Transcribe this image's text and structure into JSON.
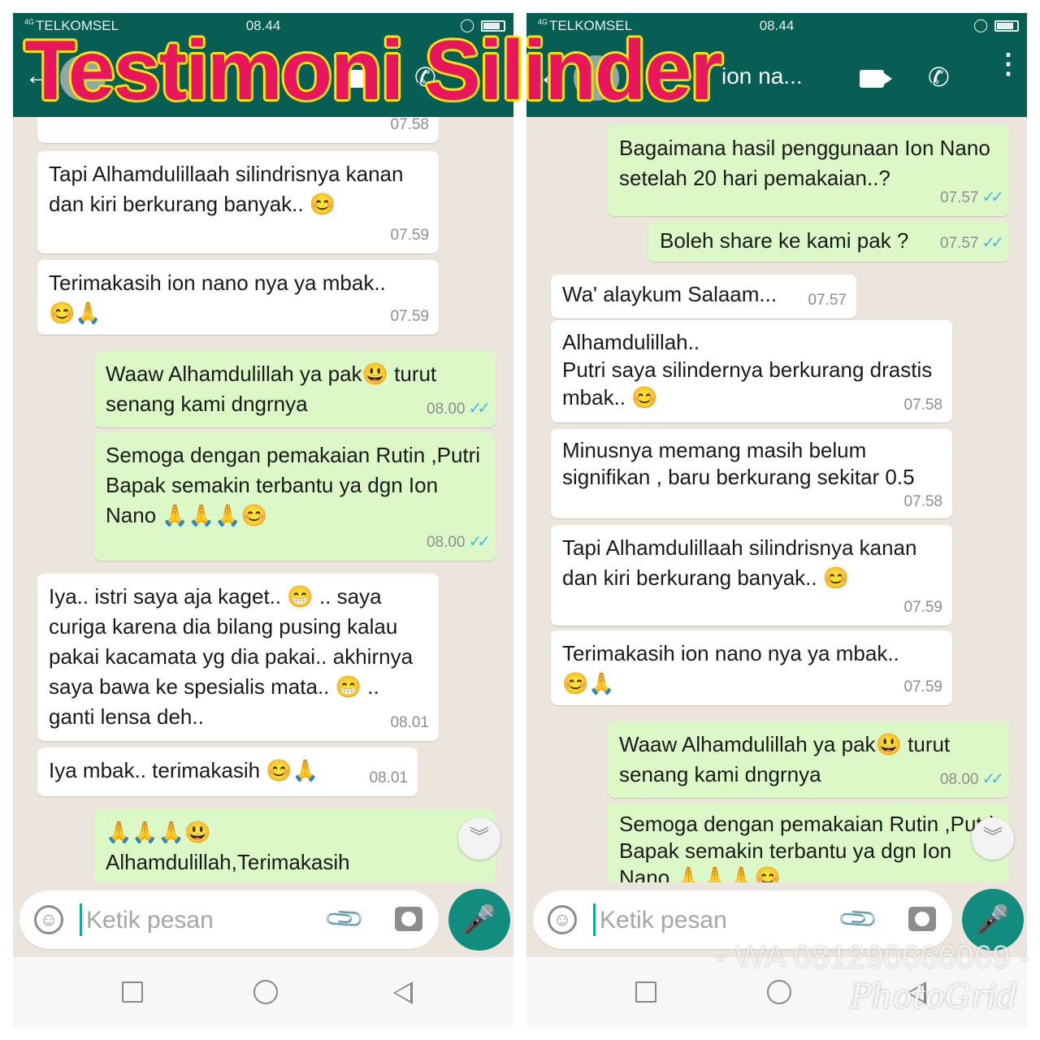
{
  "overlay": {
    "headline": "Testimoni Silinder",
    "watermark": "- WA 081290666069 -",
    "photogrid_logo": "PhotoGrid"
  },
  "status_bar": {
    "network": "4G",
    "carrier": "TELKOMSEL",
    "time": "08.44"
  },
  "right_header": {
    "contact_name_fragment": "ion na..."
  },
  "left_chat": {
    "messages": [
      {
        "dir": "in",
        "text": "",
        "time": "07.58"
      },
      {
        "dir": "in",
        "text": "Tapi Alhamdulillaah silindrisnya kanan dan kiri berkurang banyak..",
        "emoji": "😊",
        "time": "07.59"
      },
      {
        "dir": "in",
        "text": "Terimakasih ion nano nya ya mbak..",
        "emoji": "😊🙏",
        "time": "07.59"
      },
      {
        "dir": "out",
        "text_a": "Waaw Alhamdulillah ya pak",
        "emoji": "😃",
        "text_b": " turut senang kami dngrnya",
        "time": "08.00"
      },
      {
        "dir": "out",
        "text": "Semoga dengan pemakaian Rutin ,Putri Bapak semakin terbantu ya dgn Ion Nano ",
        "emoji": "🙏🙏🙏😊",
        "time": "08.00"
      },
      {
        "dir": "in",
        "text_a": "Iya.. istri saya aja kaget.. ",
        "emoji_a": "😁",
        "text_b": " .. saya curiga karena dia bilang pusing kalau pakai kacamata yg dia pakai.. akhirnya saya bawa ke spesialis mata.. ",
        "emoji_b": "😁",
        "text_c": " .. ganti lensa deh..",
        "time": "08.01"
      },
      {
        "dir": "in",
        "text": "Iya mbak.. terimakasih ",
        "emoji": "😊🙏",
        "time": "08.01"
      },
      {
        "dir": "out",
        "emoji": "🙏🙏🙏😃",
        "text": "Alhamdulillah,Terimakasih"
      }
    ]
  },
  "right_chat": {
    "messages": [
      {
        "dir": "out",
        "text": "Bagaimana hasil penggunaan Ion Nano setelah 20 hari pemakaian..?",
        "time": "07.57"
      },
      {
        "dir": "out",
        "text": "Boleh share ke kami pak ?",
        "time": "07.57"
      },
      {
        "dir": "in",
        "text": "Wa' alaykum Salaam...",
        "time": "07.57"
      },
      {
        "dir": "in",
        "text_a": "Alhamdulillah..",
        "text_b": "Putri saya silindernya berkurang drastis mbak.. ",
        "emoji": "😊",
        "time": "07.58"
      },
      {
        "dir": "in",
        "text": "Minusnya memang masih belum signifikan , baru berkurang sekitar 0.5",
        "time": "07.58"
      },
      {
        "dir": "in",
        "text": "Tapi Alhamdulillaah silindrisnya kanan dan kiri berkurang banyak..",
        "emoji": "😊",
        "time": "07.59"
      },
      {
        "dir": "in",
        "text": "Terimakasih ion nano nya ya mbak..",
        "emoji": "😊🙏",
        "time": "07.59"
      },
      {
        "dir": "out",
        "text_a": "Waaw Alhamdulillah ya pak",
        "emoji": "😃",
        "text_b": " turut senang kami dngrnya",
        "time": "08.00"
      },
      {
        "dir": "out",
        "text": "Semoga dengan pemakaian Rutin ,Putri Bapak semakin terbantu ya dgn Ion Nano ",
        "emoji": "🙏🙏🙏😊"
      }
    ]
  },
  "composer": {
    "placeholder": "Ketik pesan"
  },
  "icons": {
    "back": "arrow-left-icon",
    "video": "video-camera-icon",
    "call": "phone-icon",
    "menu": "more-vert-icon",
    "emoji": "emoji-icon",
    "attach": "paperclip-icon",
    "camera": "camera-icon",
    "mic": "mic-icon",
    "scroll": "chevron-double-down-icon",
    "read": "double-check-icon"
  },
  "colors": {
    "header": "#075e54",
    "chat_bg": "#ece5dd",
    "outgoing_bubble": "#dcf8c6",
    "incoming_bubble": "#ffffff",
    "mic_button": "#128c7e",
    "read_ticks": "#4fb6ec",
    "headline_fill": "#e8175d",
    "headline_outline": "#ffe600"
  }
}
